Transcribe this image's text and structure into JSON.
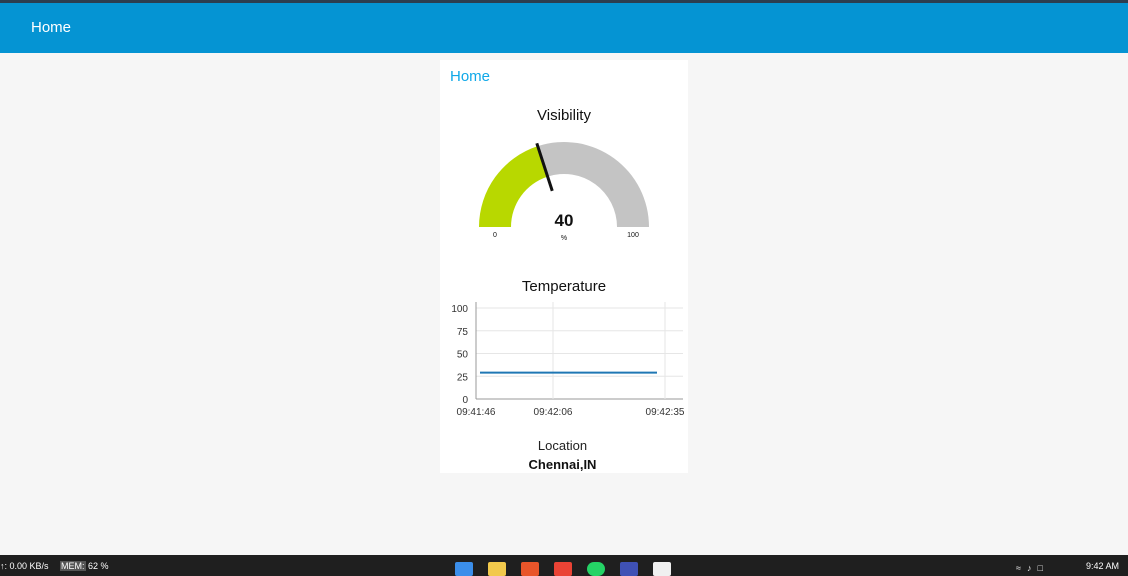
{
  "toolbar": {
    "title": "Home"
  },
  "group": {
    "title": "Home"
  },
  "gauge": {
    "title": "Visibility",
    "value": 40,
    "value_label": "40",
    "units": "%",
    "min": 0,
    "max": 100,
    "min_label": "0",
    "max_label": "100",
    "fill_color": "#b8d800",
    "track_color": "#c4c4c4"
  },
  "chart_data": {
    "type": "line",
    "title": "Temperature",
    "x": [
      "09:41:46",
      "09:42:35"
    ],
    "series": [
      {
        "values": [
          29,
          29
        ],
        "color": "#1f77b4"
      }
    ],
    "ylim": [
      0,
      100
    ],
    "yticks": [
      "100",
      "75",
      "50",
      "25",
      "0"
    ],
    "xticks": [
      "09:41:46",
      "09:42:06",
      "09:42:35"
    ],
    "grid": true
  },
  "location": {
    "label": "Location",
    "value": "Chennai,IN"
  },
  "taskbar": {
    "net": "↑: 0.00 KB/s",
    "mem_label": "MEM:",
    "mem_value": "62 %",
    "time": "9:42 AM"
  }
}
